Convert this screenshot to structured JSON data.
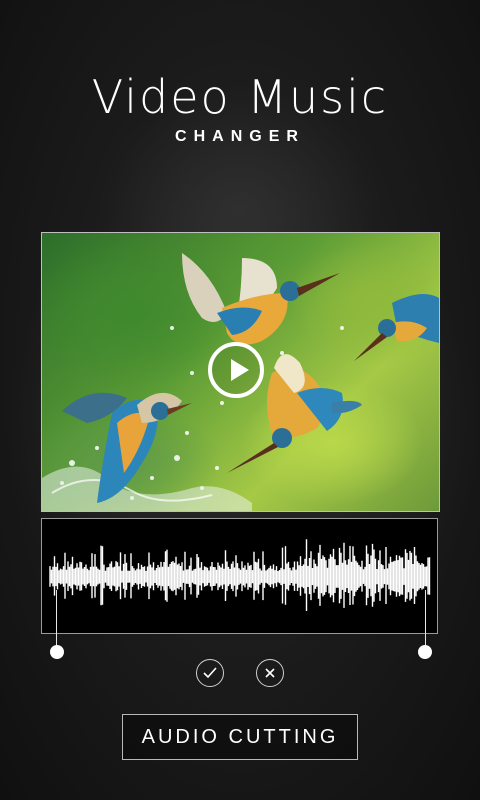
{
  "app": {
    "title": "Video Music",
    "subtitle": "CHANGER"
  },
  "video_preview": {
    "play_icon": "play-icon"
  },
  "audio_editor": {
    "confirm_icon": "check-icon",
    "cancel_icon": "close-icon",
    "action_label": "AUDIO CUTTING"
  },
  "colors": {
    "background": "#1c1c1c",
    "waveform": "#ffffff",
    "waveform_bg": "#000000"
  }
}
